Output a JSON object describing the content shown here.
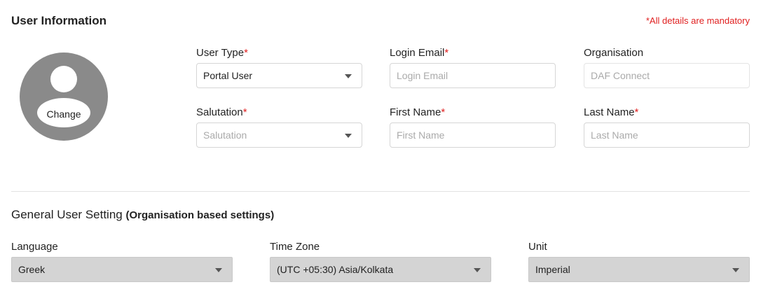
{
  "user_info": {
    "title": "User Information",
    "mandatory_note": "*All details are mandatory",
    "avatar": {
      "change_label": "Change",
      "icon": "user-avatar-icon"
    },
    "user_type": {
      "label": "User Type",
      "required_mark": "*",
      "value": "Portal User"
    },
    "login_email": {
      "label": "Login Email",
      "required_mark": "*",
      "placeholder": "Login Email"
    },
    "organisation": {
      "label": "Organisation",
      "value": "DAF Connect"
    },
    "salutation": {
      "label": "Salutation",
      "required_mark": "*",
      "placeholder": "Salutation"
    },
    "first_name": {
      "label": "First Name",
      "required_mark": "*",
      "placeholder": "First Name"
    },
    "last_name": {
      "label": "Last Name",
      "required_mark": "*",
      "placeholder": "Last Name"
    }
  },
  "general_settings": {
    "title": "General User Setting",
    "subtitle": "(Organisation based settings)",
    "language": {
      "label": "Language",
      "value": "Greek"
    },
    "time_zone": {
      "label": "Time Zone",
      "value": "(UTC +05:30) Asia/Kolkata"
    },
    "unit": {
      "label": "Unit",
      "value": "Imperial"
    }
  },
  "colors": {
    "required": "#e02020",
    "avatar_bg": "#8a8a8a",
    "select_grey": "#d4d4d4"
  }
}
